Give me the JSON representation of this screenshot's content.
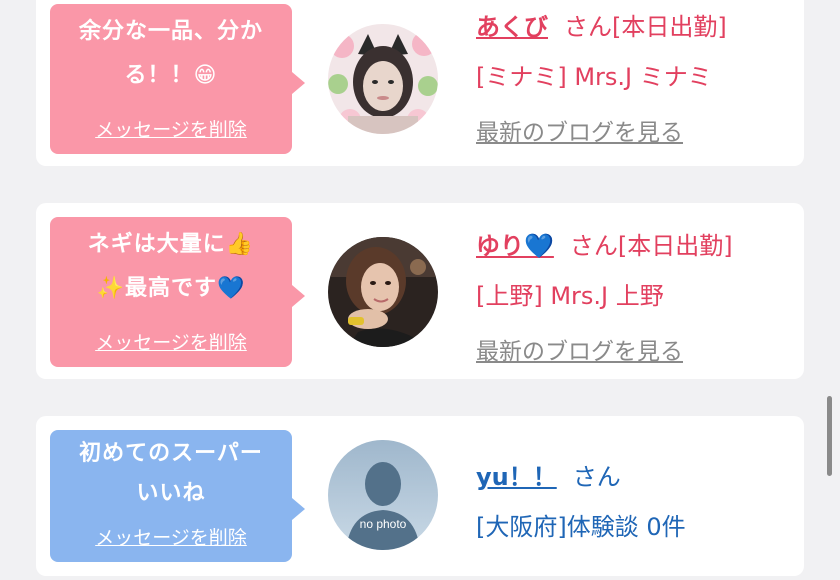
{
  "colors": {
    "pink_bubble": "#fa97a8",
    "blue_bubble": "#8ab5ef",
    "pink_text": "#e2405f",
    "blue_text": "#1f66b6",
    "muted_link": "#8a8a8a"
  },
  "messages": [
    {
      "text": "余分な一品、分か\nる！！😁",
      "delete_label": "メッセージを削除",
      "name": "あくび",
      "suffix": "さん[本日出勤]",
      "shop": "[ミナミ] Mrs.J ミナミ",
      "blog_label": "最新のブログを見る",
      "avatar": "profile-photo-cat-ears"
    },
    {
      "text": "ネギは大量に👍\n✨最高です💙",
      "delete_label": "メッセージを削除",
      "name": "ゆり💙",
      "suffix": "さん[本日出勤]",
      "shop": "[上野] Mrs.J 上野",
      "blog_label": "最新のブログを見る",
      "avatar": "profile-photo-woman"
    },
    {
      "text": "初めてのスーパー\nいいね",
      "delete_label": "メッセージを削除",
      "name": "yu！！",
      "suffix": "さん",
      "shop": "[大阪府]体験談 0件",
      "avatar": "no-photo-silhouette",
      "avatar_caption": "no photo"
    }
  ]
}
